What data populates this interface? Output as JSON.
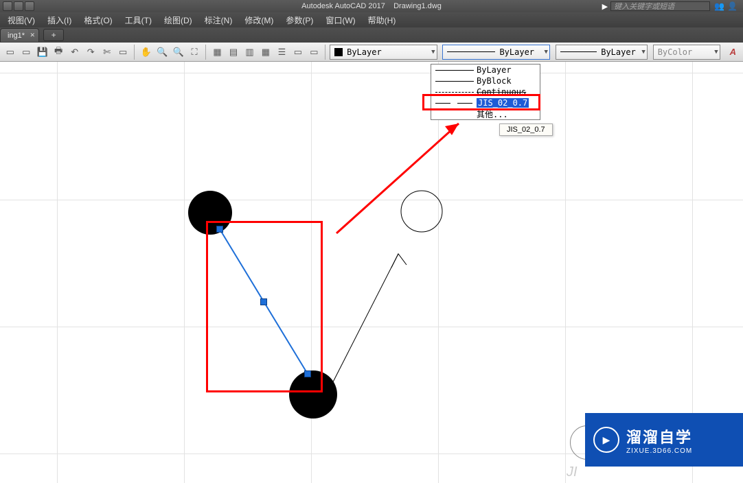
{
  "title": {
    "app": "Autodesk AutoCAD 2017",
    "doc": "Drawing1.dwg"
  },
  "search": {
    "placeholder": "键入关键字或短语"
  },
  "menus": [
    "视图(V)",
    "插入(I)",
    "格式(O)",
    "工具(T)",
    "绘图(D)",
    "标注(N)",
    "修改(M)",
    "参数(P)",
    "窗口(W)",
    "帮助(H)"
  ],
  "doc_tab": {
    "label": "ing1*"
  },
  "props": {
    "layer_color": "ByLayer",
    "linetype_sel": "ByLayer",
    "lineweight": "ByLayer",
    "plotstyle": "ByColor"
  },
  "linetypes": {
    "items": [
      {
        "style": "cont",
        "label": "ByLayer"
      },
      {
        "style": "cont",
        "label": "ByBlock"
      },
      {
        "style": "dash",
        "label": "Continuous"
      },
      {
        "style": "sdash",
        "label": "JIS_02_0.7",
        "highlight": true
      },
      {
        "style": "none",
        "label": "其他..."
      }
    ]
  },
  "tooltip": "JIS_02_0.7",
  "watermark": {
    "zh": "溜溜自学",
    "url": "ZIXUE.3D66.COM"
  }
}
